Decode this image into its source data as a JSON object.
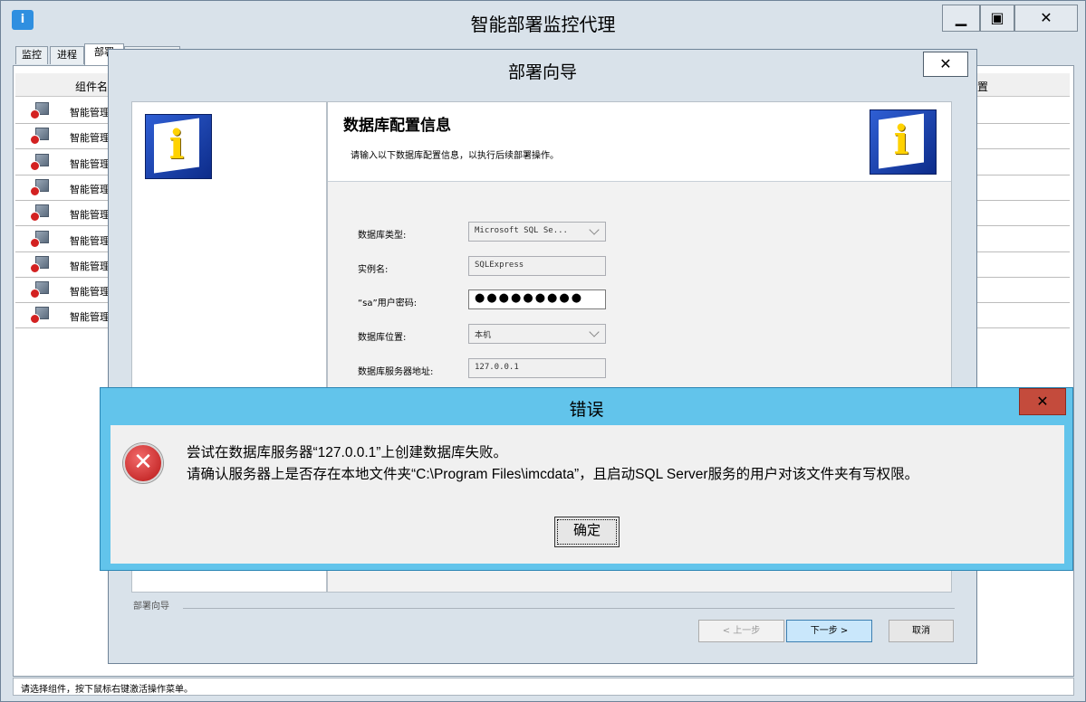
{
  "main_window": {
    "title": "智能部署监控代理",
    "app_icon_text": "i",
    "controls": {
      "minimize": "▁",
      "maximize": "▣",
      "close": "✕"
    }
  },
  "tabs": [
    {
      "label": "监控"
    },
    {
      "label": "进程"
    },
    {
      "label": "部署"
    },
    {
      "label": ""
    }
  ],
  "component_list": {
    "columns": {
      "name": "组件名",
      "position": "置"
    },
    "rows": [
      {
        "name": "智能管理"
      },
      {
        "name": "智能管理"
      },
      {
        "name": "智能管理"
      },
      {
        "name": "智能管理"
      },
      {
        "name": "智能管理"
      },
      {
        "name": "智能管理"
      },
      {
        "name": "智能管理"
      },
      {
        "name": "智能管理"
      },
      {
        "name": "智能管理"
      }
    ]
  },
  "status_bar": {
    "text": "请选择组件，按下鼠标右键激活操作菜单。"
  },
  "wizard": {
    "title": "部署向导",
    "close": "✕",
    "heading": "数据库配置信息",
    "subheading": "请输入以下数据库配置信息，以执行后续部署操作。",
    "form": {
      "db_type_label": "数据库类型:",
      "db_type_value": "Microsoft SQL Se...",
      "instance_label": "实例名:",
      "instance_value": "SQLExpress",
      "password_label": "“sa”用户密码:",
      "password_value": "●●●●●●●●●",
      "location_label": "数据库位置:",
      "location_value": "本机",
      "server_label": "数据库服务器地址:",
      "server_value": "127.0.0.1"
    },
    "section_label": "部署向导",
    "buttons": {
      "prev": "< 上一步",
      "next": "下一步 >",
      "cancel": "取消"
    }
  },
  "error_dialog": {
    "title": "错误",
    "close": "✕",
    "icon": "✕",
    "line1": "尝试在数据库服务器“127.0.0.1”上创建数据库失败。",
    "line2": "请确认服务器上是否存在本地文件夹“C:\\Program Files\\imcdata”，且启动SQL Server服务的用户对该文件夹有写权限。",
    "ok": "确定"
  }
}
